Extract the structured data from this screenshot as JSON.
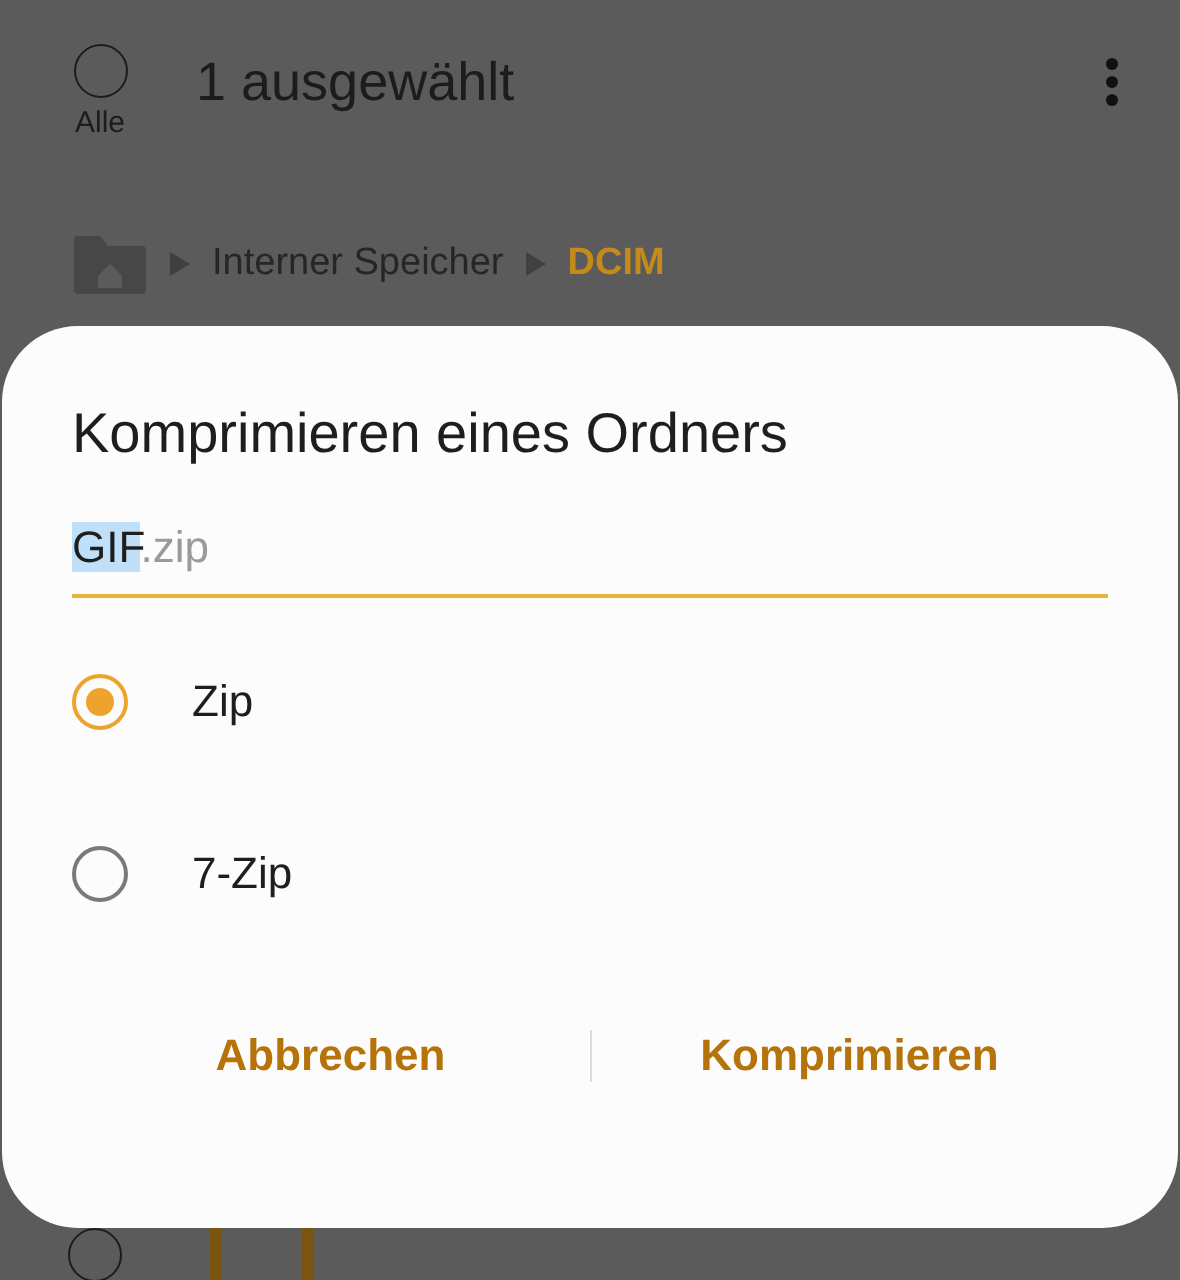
{
  "header": {
    "select_all": {
      "label": "Alle",
      "checked": false
    },
    "title": "1 ausgewählt"
  },
  "breadcrumb": [
    "Interner Speicher",
    "DCIM"
  ],
  "list": [
    {
      "checked": false
    }
  ],
  "dialog": {
    "title": "Komprimieren eines Ordners",
    "filename": {
      "name": "GIF",
      "name_selected": true,
      "extension": ".zip"
    },
    "formats": [
      {
        "label": "Zip",
        "selected": true
      },
      {
        "label": "7-Zip",
        "selected": false
      }
    ],
    "buttons": [
      "Abbrechen",
      "Komprimieren"
    ]
  }
}
